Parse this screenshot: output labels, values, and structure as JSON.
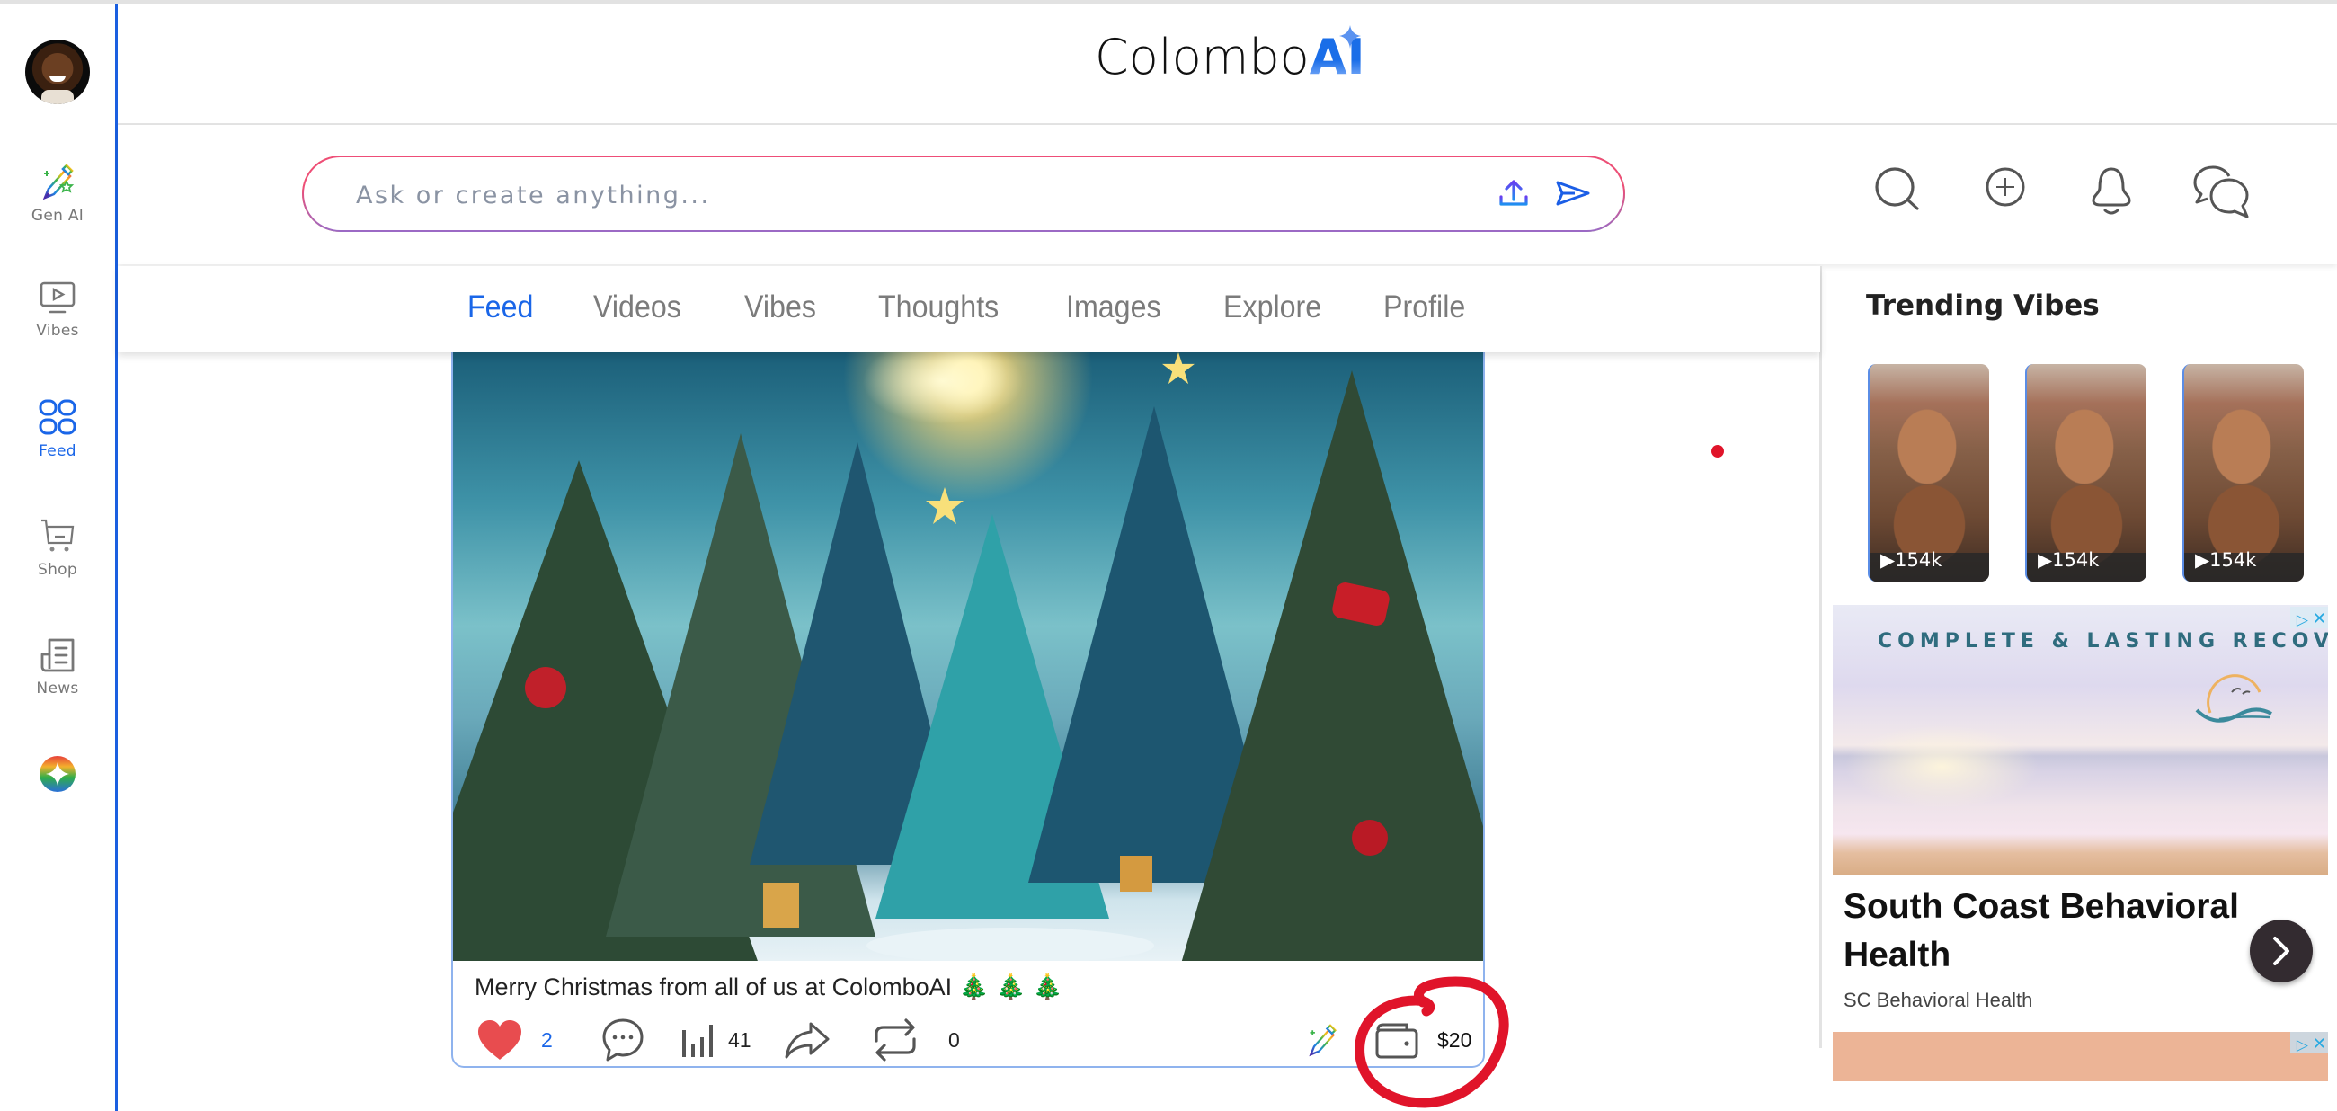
{
  "app": {
    "title_main": "Colombo",
    "title_accent": "AI"
  },
  "sidebar": {
    "avatar_alt": "User profile photo",
    "items": [
      {
        "label": "Gen AI",
        "icon": "gen-ai-pencil-icon",
        "active": false
      },
      {
        "label": "Vibes",
        "icon": "tv-play-icon",
        "active": false
      },
      {
        "label": "Feed",
        "icon": "grid-icon",
        "active": true
      },
      {
        "label": "Shop",
        "icon": "cart-icon",
        "active": false
      },
      {
        "label": "News",
        "icon": "newspaper-icon",
        "active": false
      }
    ],
    "extra_icon": "rainbow-star-icon"
  },
  "search": {
    "placeholder": "Ask or create anything...",
    "value": "",
    "upload_icon": "upload-icon",
    "send_icon": "send-icon"
  },
  "header_actions": [
    {
      "name": "search",
      "icon": "search-icon"
    },
    {
      "name": "create",
      "icon": "plus-circle-icon"
    },
    {
      "name": "notifications",
      "icon": "bell-icon"
    },
    {
      "name": "messages",
      "icon": "chat-bubbles-icon"
    }
  ],
  "tabs": [
    {
      "label": "Feed",
      "active": true
    },
    {
      "label": "Videos",
      "active": false
    },
    {
      "label": "Vibes",
      "active": false
    },
    {
      "label": "Thoughts",
      "active": false
    },
    {
      "label": "Images",
      "active": false
    },
    {
      "label": "Explore",
      "active": false
    },
    {
      "label": "Profile",
      "active": false
    }
  ],
  "post": {
    "image_alt": "Snowy forest of decorated Christmas trees with a glowing star",
    "caption": "Merry Christmas from all of us at ColomboAI 🎄 🎄 🎄",
    "likes": "2",
    "views": "41",
    "reposts": "0",
    "tip_amount": "$20",
    "liked": true
  },
  "trending": {
    "title": "Trending Vibes",
    "items": [
      {
        "views": "154k"
      },
      {
        "views": "154k"
      },
      {
        "views": "154k"
      }
    ]
  },
  "ad": {
    "headline": "COMPLETE & LASTING RECOVERY",
    "title": "South Coast Behavioral Health",
    "advertiser": "SC Behavioral Health",
    "info_icon": "▷",
    "close_icon": "✕"
  },
  "colors": {
    "accent": "#1a66e8",
    "heart": "#e84c4f",
    "annotation": "#e0142a",
    "sidebar_border": "#1a5fe0"
  }
}
